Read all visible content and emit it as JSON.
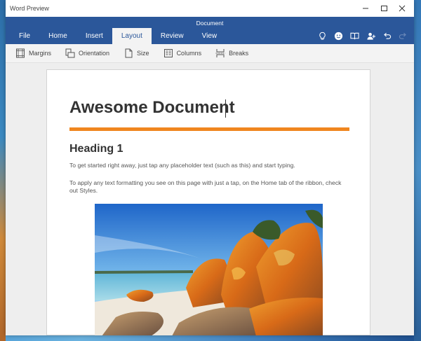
{
  "window": {
    "app_title": "Word Preview",
    "doc_name": "Document"
  },
  "tabs": [
    {
      "label": "File"
    },
    {
      "label": "Home"
    },
    {
      "label": "Insert"
    },
    {
      "label": "Layout"
    },
    {
      "label": "Review"
    },
    {
      "label": "View"
    }
  ],
  "active_tab": "Layout",
  "tab_tools": [
    "lightbulb-icon",
    "smiley-icon",
    "book-icon",
    "share-user-icon",
    "undo-icon",
    "redo-icon"
  ],
  "ribbon": {
    "items": [
      {
        "label": "Margins",
        "icon": "margins-icon"
      },
      {
        "label": "Orientation",
        "icon": "orientation-icon"
      },
      {
        "label": "Size",
        "icon": "size-icon"
      },
      {
        "label": "Columns",
        "icon": "columns-icon"
      },
      {
        "label": "Breaks",
        "icon": "breaks-icon"
      }
    ]
  },
  "document": {
    "title": "Awesome Document",
    "heading": "Heading 1",
    "para1": "To get started right away, just tap any placeholder text (such as this) and start typing.",
    "para2": "To apply any text formatting you see on this page with just a tap, on the Home tab of the ribbon, check out Styles.",
    "accent_color": "#f0861f"
  },
  "colors": {
    "ribbon": "#2b579a",
    "ribbon_body": "#f3f3f3"
  }
}
